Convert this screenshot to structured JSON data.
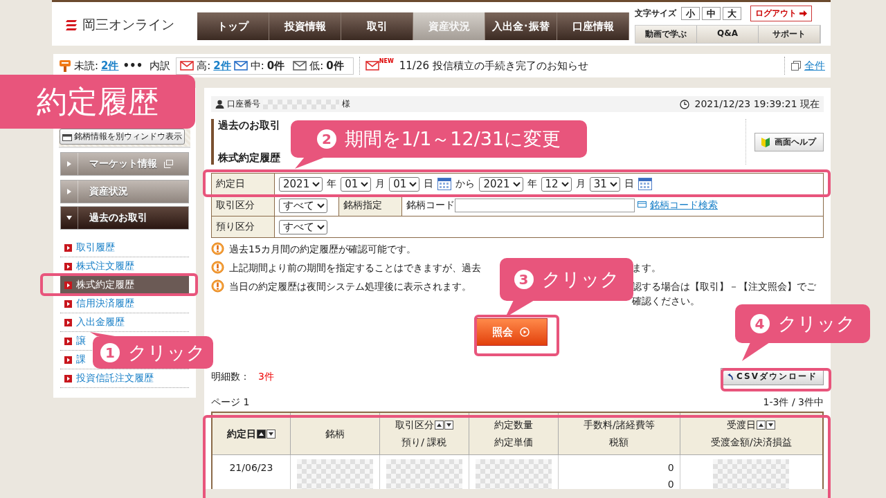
{
  "header": {
    "logo": "岡三オンライン",
    "nav": [
      {
        "label": "トップ",
        "selected": false
      },
      {
        "label": "投資情報",
        "selected": false
      },
      {
        "label": "取引",
        "selected": false
      },
      {
        "label": "資産状況",
        "selected": true
      },
      {
        "label": "入出金･振替",
        "selected": false
      },
      {
        "label": "口座情報",
        "selected": false
      }
    ],
    "font_size_label": "文字サイズ",
    "font_sizes": [
      "小",
      "中",
      "大"
    ],
    "logout": "ログアウト",
    "links": [
      "動画で学ぶ",
      "Q&A",
      "サポート"
    ]
  },
  "messages": {
    "unread_label": "未読:",
    "unread_count": "2件",
    "more": "•••",
    "breakdown_label": "内訳",
    "levels": [
      {
        "label": "高:",
        "count": "2件",
        "kind": "high"
      },
      {
        "label": "中:",
        "count": "0件",
        "kind": "mid"
      },
      {
        "label": "低:",
        "count": "0件",
        "kind": "low"
      }
    ],
    "new_badge": "NEW",
    "notice": "11/26 投信積立の手続き完了のお知らせ",
    "all_link": "全件"
  },
  "sidebar": {
    "window_button": "銘柄情報を別ウィンドウ表示",
    "sections": [
      {
        "label": "マーケット情報",
        "kind": "external",
        "expanded": false
      },
      {
        "label": "資産状況",
        "kind": "plain",
        "expanded": false
      },
      {
        "label": "過去のお取引",
        "kind": "plain",
        "expanded": true
      }
    ],
    "links": [
      {
        "label": "取引履歴",
        "selected": false
      },
      {
        "label": "株式注文履歴",
        "selected": false
      },
      {
        "label": "株式約定履歴",
        "selected": true
      },
      {
        "label": "信用決済履歴",
        "selected": false
      },
      {
        "label": "入出金履歴",
        "selected": false
      },
      {
        "label": "譲",
        "selected": false
      },
      {
        "label": "課",
        "selected": false
      },
      {
        "label": "投資信託注文履歴",
        "selected": false
      }
    ]
  },
  "account": {
    "label": "口座番号",
    "suffix": "様",
    "timestamp": "2021/12/23 19:39:21 現在"
  },
  "page_title": {
    "category": "過去のお取引",
    "title": "株式約定履歴"
  },
  "help_button": "画面ヘルプ",
  "form": {
    "date": {
      "label": "約定日",
      "parts": [
        {
          "kind": "select",
          "value": "2021"
        },
        {
          "kind": "text",
          "value": "年"
        },
        {
          "kind": "select",
          "value": "01"
        },
        {
          "kind": "text",
          "value": "月"
        },
        {
          "kind": "select",
          "value": "01"
        },
        {
          "kind": "text",
          "value": "日"
        },
        {
          "kind": "calendar"
        },
        {
          "kind": "text",
          "value": "から"
        },
        {
          "kind": "select",
          "value": "2021"
        },
        {
          "kind": "text",
          "value": "年"
        },
        {
          "kind": "select",
          "value": "12"
        },
        {
          "kind": "text",
          "value": "月"
        },
        {
          "kind": "select",
          "value": "31"
        },
        {
          "kind": "text",
          "value": "日"
        },
        {
          "kind": "calendar"
        }
      ]
    },
    "trade_type": {
      "label": "取引区分",
      "value": "すべて"
    },
    "issue": {
      "label": "銘柄指定",
      "code_label": "銘柄コード",
      "search_link": "銘柄コード検索"
    },
    "deposit_type": {
      "label": "預り区分",
      "value": "すべて"
    }
  },
  "notes": [
    {
      "parts": [
        "過去15カ月間の約定履歴が確認可能です。"
      ]
    },
    {
      "parts": [
        "上記期間より前の期間を指定することはできますが、過去",
        "ます。"
      ]
    },
    {
      "parts": [
        "当日の約定履歴は夜間システム処理後に表示されます。",
        "認する場合は【取引】－【注文照会】でご確認ください。"
      ]
    }
  ],
  "search_button": "照会",
  "count_label": "明細数：",
  "count": "3件",
  "csv_button": "CSVダウンロード",
  "page_label": "ページ 1",
  "range": "1-3件 / 3件中",
  "table": {
    "columns": [
      {
        "lines": [
          {
            "text": "約定日",
            "sortable": true
          }
        ],
        "bold": true
      },
      {
        "lines": [
          {
            "text": "銘柄",
            "sortable": false
          }
        ],
        "bold": false
      },
      {
        "lines": [
          {
            "text": "取引区分",
            "sortable": true
          },
          {
            "text": "預り/ 課税",
            "sortable": false
          }
        ],
        "bold": false
      },
      {
        "lines": [
          {
            "text": "約定数量",
            "sortable": false
          },
          {
            "text": "約定単価",
            "sortable": false
          }
        ],
        "bold": false
      },
      {
        "lines": [
          {
            "text": "手数料/諸経費等",
            "sortable": false
          },
          {
            "text": "税額",
            "sortable": false
          }
        ],
        "bold": false
      },
      {
        "lines": [
          {
            "text": "受渡日",
            "sortable": true
          },
          {
            "text": "受渡金額/決済損益",
            "sortable": false
          }
        ],
        "bold": false
      }
    ],
    "rows": [
      {
        "cells": [
          {
            "kind": "date",
            "lines": [
              "21/06/23"
            ]
          },
          {
            "kind": "masked"
          },
          {
            "kind": "masked"
          },
          {
            "kind": "masked"
          },
          {
            "kind": "number",
            "lines": [
              "0",
              "0"
            ]
          },
          {
            "kind": "masked"
          }
        ]
      }
    ]
  },
  "annotations": [
    {
      "kind": "title",
      "text": "約定履歴"
    },
    {
      "kind": "step",
      "number": "1",
      "text": "クリック"
    },
    {
      "kind": "step",
      "number": "2",
      "text": "期間を1/1～12/31に変更"
    },
    {
      "kind": "step",
      "number": "3",
      "text": "クリック"
    },
    {
      "kind": "step",
      "number": "4",
      "text": "クリック"
    }
  ]
}
